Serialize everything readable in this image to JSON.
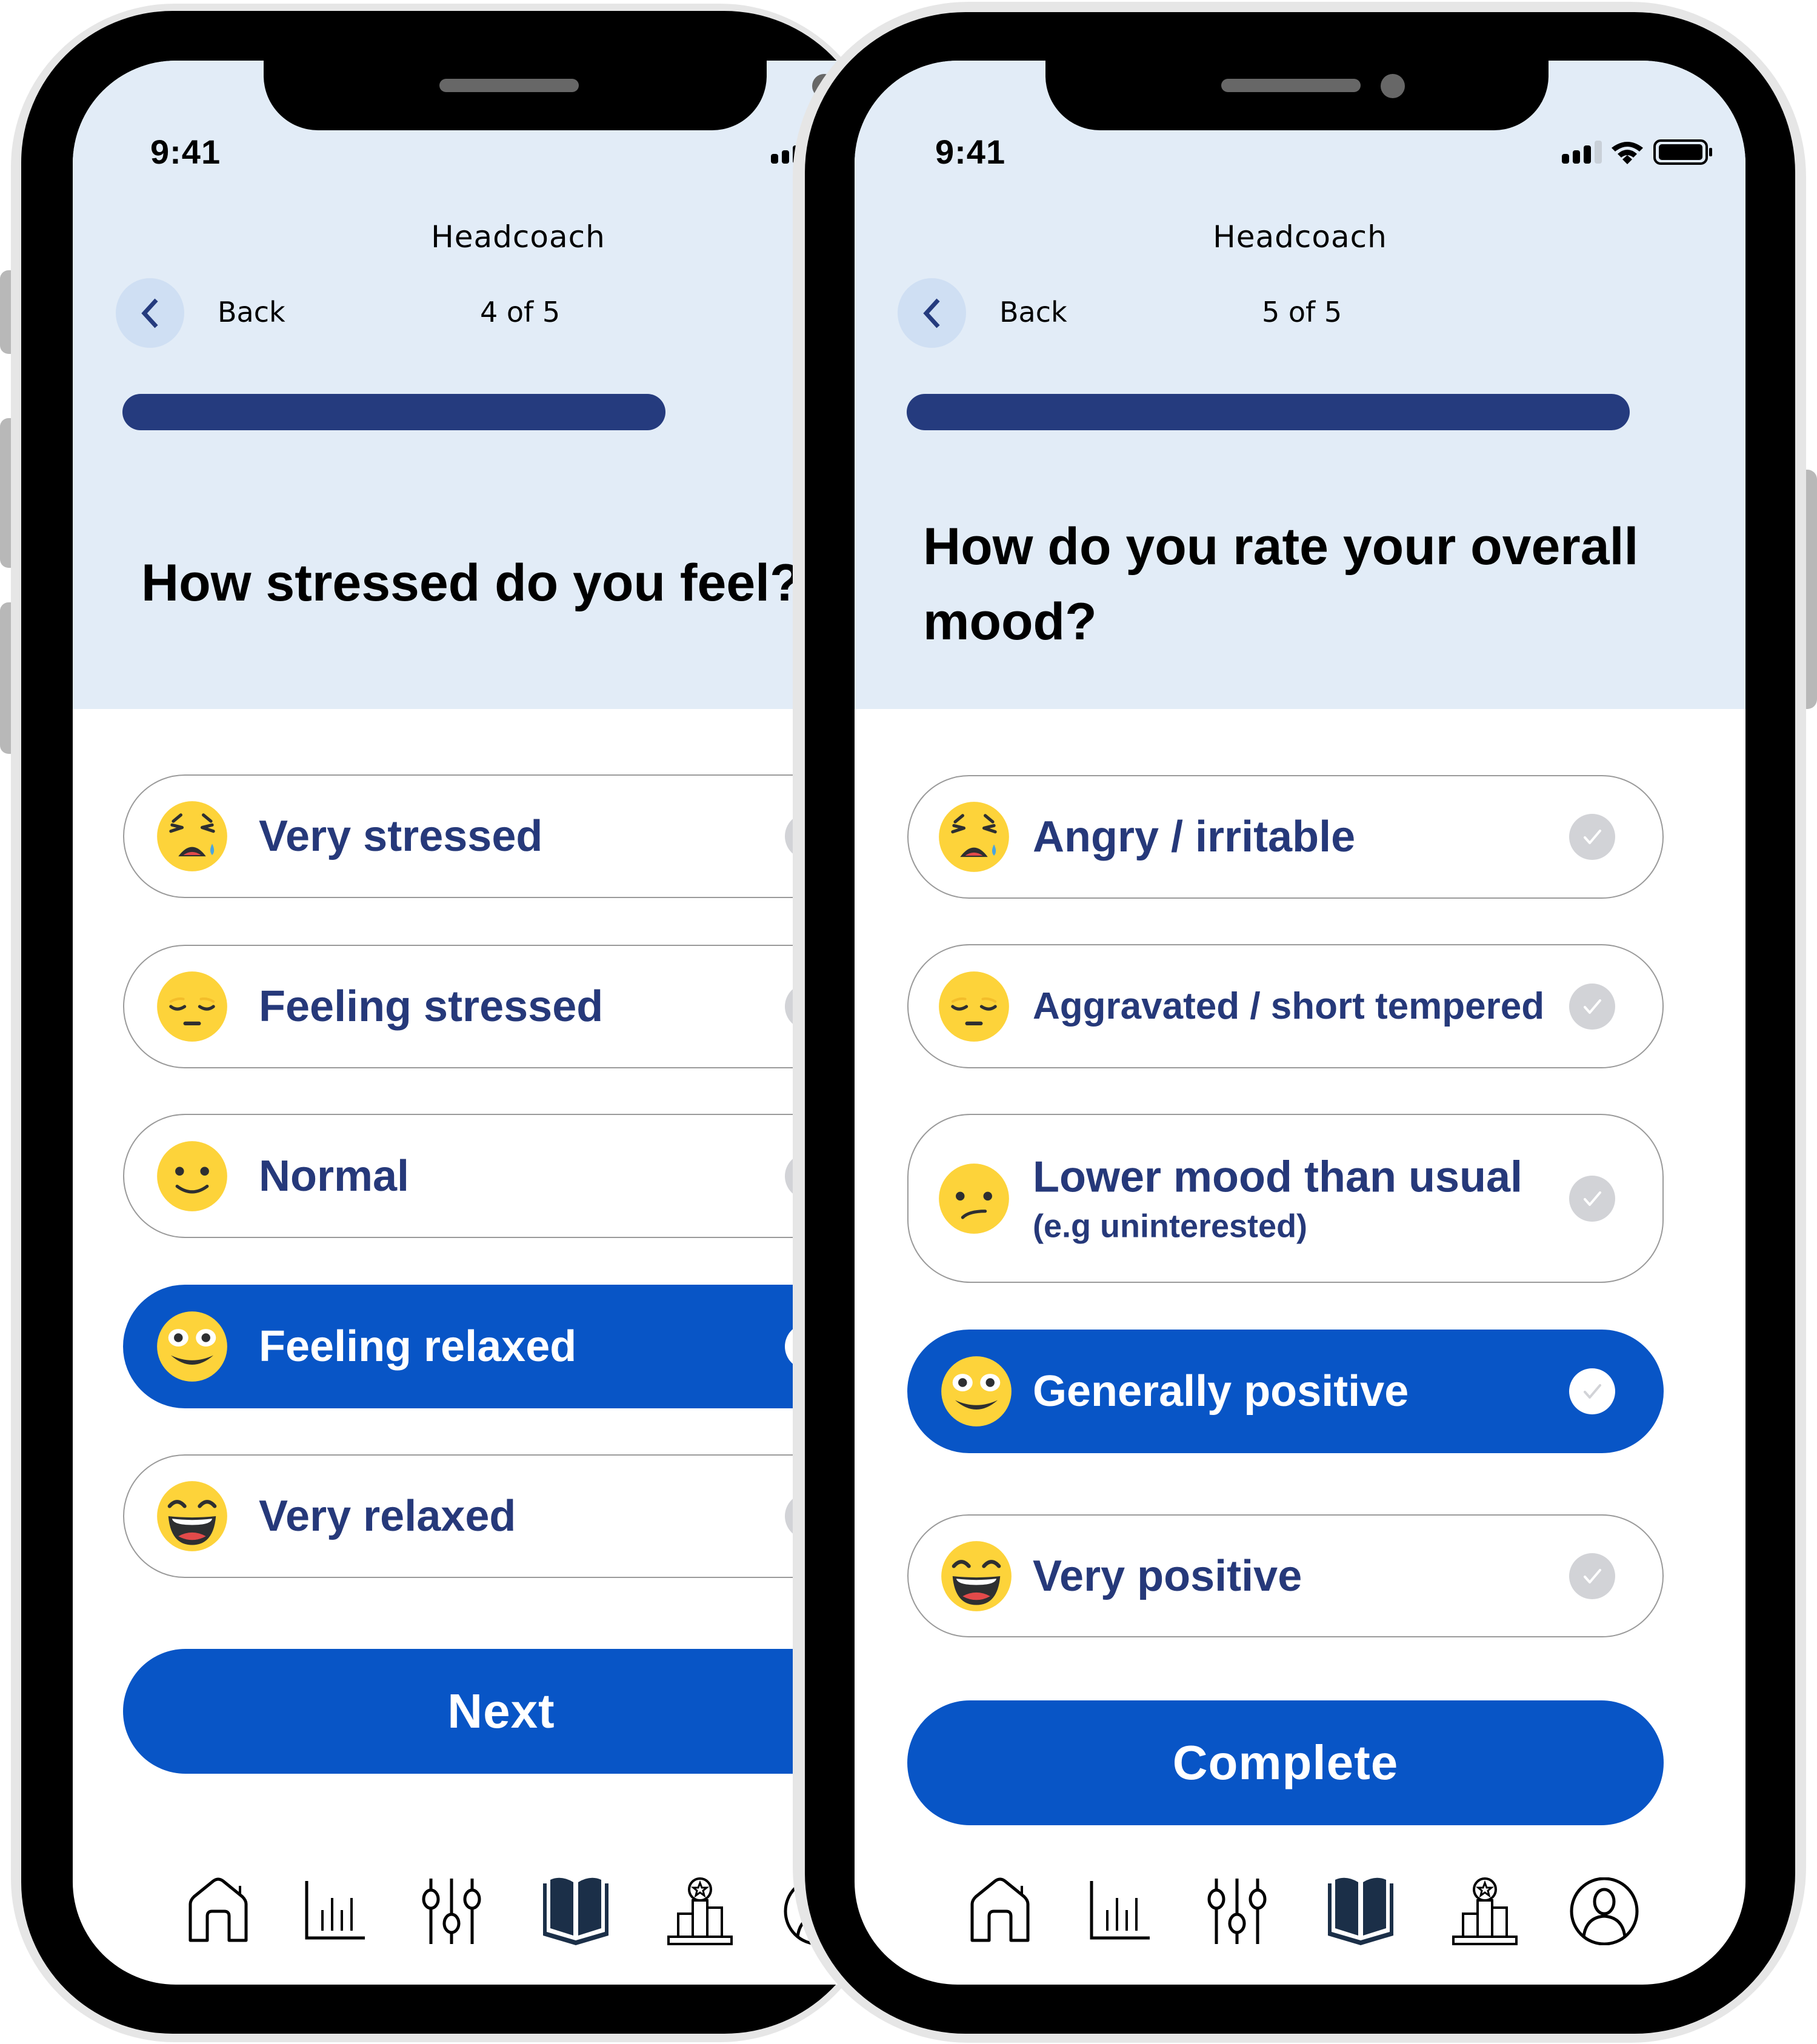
{
  "app": {
    "title": "Headcoach",
    "time": "9:41",
    "back_label": "Back",
    "colors": {
      "header_bg": "#e2ecf7",
      "primary_blue": "#0855c6",
      "progress_navy": "#253b7e",
      "option_text_navy": "#26397a",
      "check_gray": "#d2d3d7",
      "back_button_bg": "#cfdff3"
    }
  },
  "status_bar": {
    "icons": [
      "signal-icon",
      "wifi-icon",
      "battery-icon"
    ]
  },
  "screens": [
    {
      "step_label": "4 of 5",
      "progress": 0.8,
      "question": "How stressed do you feel?",
      "options": [
        {
          "emoji": "weary-face",
          "label": "Very stressed",
          "sublabel": "",
          "selected": false
        },
        {
          "emoji": "pensive-face",
          "label": "Feeling stressed",
          "sublabel": "",
          "selected": false
        },
        {
          "emoji": "slightly-smiling-face",
          "label": "Normal",
          "sublabel": "",
          "selected": false
        },
        {
          "emoji": "grinning-wide-eyes-face",
          "label": "Feeling relaxed",
          "sublabel": "",
          "selected": true
        },
        {
          "emoji": "laughing-face",
          "label": "Very relaxed",
          "sublabel": "",
          "selected": false
        }
      ],
      "cta_label": "Next"
    },
    {
      "step_label": "5 of 5",
      "progress": 1.0,
      "question": "How do you rate your overall\nmood?",
      "options": [
        {
          "emoji": "weary-face",
          "label": "Angry / irritable",
          "sublabel": "",
          "selected": false
        },
        {
          "emoji": "pensive-face",
          "label": "Aggravated / short tempered",
          "sublabel": "",
          "selected": false
        },
        {
          "emoji": "confused-face",
          "label": "Lower mood than usual",
          "sublabel": "(e.g uninterested)",
          "selected": false
        },
        {
          "emoji": "grinning-wide-eyes-face",
          "label": "Generally positive",
          "sublabel": "",
          "selected": true
        },
        {
          "emoji": "laughing-face",
          "label": "Very positive",
          "sublabel": "",
          "selected": false
        }
      ],
      "cta_label": "Complete"
    }
  ],
  "bottom_nav": {
    "items": [
      {
        "icon": "home-icon",
        "active": false
      },
      {
        "icon": "bar-chart-icon",
        "active": false
      },
      {
        "icon": "sliders-icon",
        "active": false
      },
      {
        "icon": "book-icon",
        "active": true
      },
      {
        "icon": "trophy-podium-icon",
        "active": false
      },
      {
        "icon": "profile-icon",
        "active": false
      }
    ]
  }
}
